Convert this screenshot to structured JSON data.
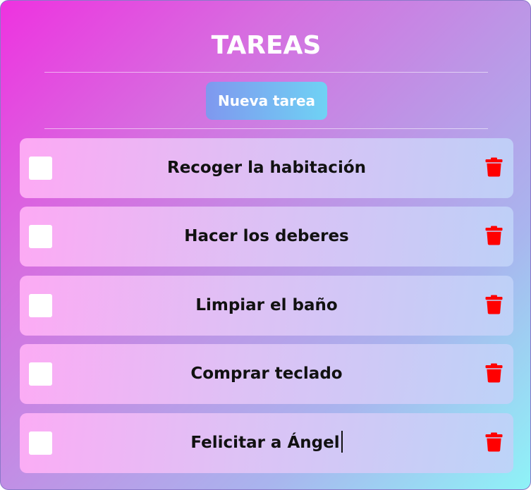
{
  "header": {
    "title": "TAREAS"
  },
  "toolbar": {
    "new_task_label": "Nueva tarea"
  },
  "tasks": [
    {
      "label": "Recoger la habitación",
      "checked": false,
      "editing": false
    },
    {
      "label": "Hacer los deberes",
      "checked": false,
      "editing": false
    },
    {
      "label": "Limpiar el baño",
      "checked": false,
      "editing": false
    },
    {
      "label": "Comprar teclado",
      "checked": false,
      "editing": false
    },
    {
      "label": "Felicitar a Ángel",
      "checked": false,
      "editing": true
    }
  ],
  "icons": {
    "delete": "trash-icon",
    "checkbox": "empty-checkbox"
  },
  "colors": {
    "title_text": "#ffffff",
    "button_gradient_start": "#7f98ef",
    "button_gradient_end": "#6fd2f4",
    "trash_icon": "#ff0000",
    "task_text": "#111111"
  }
}
